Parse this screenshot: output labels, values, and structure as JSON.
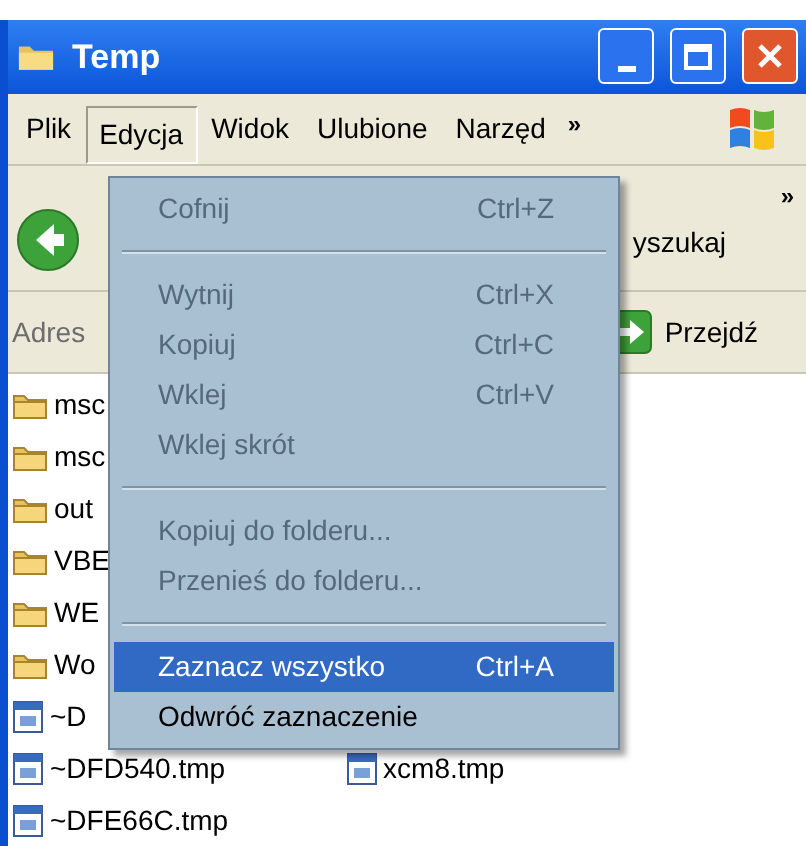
{
  "window": {
    "title": "Temp"
  },
  "menu_bar": {
    "items": [
      {
        "label": "Plik",
        "selected": false
      },
      {
        "label": "Edycja",
        "selected": true
      },
      {
        "label": "Widok",
        "selected": false
      },
      {
        "label": "Ulubione",
        "selected": false
      },
      {
        "label": "Narzęd",
        "selected": false
      }
    ],
    "overflow": "»"
  },
  "toolbar": {
    "search_label": "yszukaj",
    "overflow": "»"
  },
  "address_bar": {
    "label": "Adres",
    "go_label": "Przejdź"
  },
  "file_rows": [
    [
      {
        "kind": "folder",
        "name": "msc"
      }
    ],
    [
      {
        "kind": "folder",
        "name": "msc"
      }
    ],
    [
      {
        "kind": "folder",
        "name": "out"
      }
    ],
    [
      {
        "kind": "folder",
        "name": "VBE"
      }
    ],
    [
      {
        "kind": "folder",
        "name": "WE"
      }
    ],
    [
      {
        "kind": "folder",
        "name": "Wo"
      }
    ],
    [
      {
        "kind": "file",
        "name": "~D"
      }
    ],
    [
      {
        "kind": "file",
        "name": "~DFD540.tmp"
      },
      {
        "kind": "file",
        "name": "xcm8.tmp"
      }
    ],
    [
      {
        "kind": "file",
        "name": "~DFE66C.tmp"
      }
    ]
  ],
  "edit_menu": {
    "items": [
      {
        "kind": "command",
        "label": "Cofnij",
        "shortcut": "Ctrl+Z",
        "disabled": true,
        "selected": false
      },
      {
        "kind": "separator"
      },
      {
        "kind": "command",
        "label": "Wytnij",
        "shortcut": "Ctrl+X",
        "disabled": true,
        "selected": false
      },
      {
        "kind": "command",
        "label": "Kopiuj",
        "shortcut": "Ctrl+C",
        "disabled": true,
        "selected": false
      },
      {
        "kind": "command",
        "label": "Wklej",
        "shortcut": "Ctrl+V",
        "disabled": true,
        "selected": false
      },
      {
        "kind": "command",
        "label": "Wklej skrót",
        "disabled": true,
        "selected": false
      },
      {
        "kind": "separator"
      },
      {
        "kind": "command",
        "label": "Kopiuj do folderu...",
        "disabled": true,
        "selected": false
      },
      {
        "kind": "command",
        "label": "Przenieś do folderu...",
        "disabled": true,
        "selected": false
      },
      {
        "kind": "separator"
      },
      {
        "kind": "command",
        "label": "Zaznacz wszystko",
        "shortcut": "Ctrl+A",
        "disabled": false,
        "selected": true
      },
      {
        "kind": "command",
        "label": "Odwróć zaznaczenie",
        "disabled": false,
        "selected": false
      }
    ]
  }
}
